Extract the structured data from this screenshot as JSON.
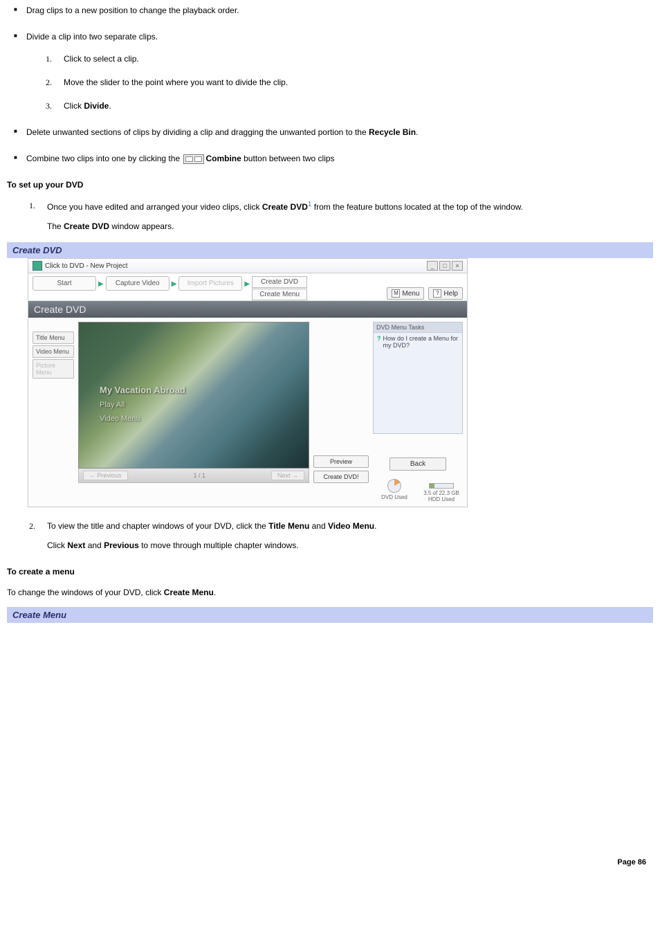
{
  "bullets": {
    "drag": "Drag clips to a new position to change the playback order.",
    "divide_intro": "Divide a clip into two separate clips.",
    "divide_steps": {
      "s1": "Click to select a clip.",
      "s2": "Move the slider to the point where you want to divide the clip.",
      "s3_a": "Click ",
      "s3_b": "Divide",
      "s3_c": "."
    },
    "delete_a": "Delete unwanted sections of clips by dividing a clip and dragging the unwanted portion to the ",
    "delete_b": "Recycle Bin",
    "delete_c": ".",
    "combine_a": "Combine two clips into one by clicking the ",
    "combine_b": "Combine",
    "combine_c": " button between two clips"
  },
  "setup_heading": "To set up your DVD",
  "setup": {
    "s1_a": "Once you have edited and arranged your video clips, click ",
    "s1_b": "Create DVD",
    "s1_sup": "1",
    "s1_c": " from the feature buttons located at the top of the window.",
    "s1_follow_a": "The ",
    "s1_follow_b": "Create DVD",
    "s1_follow_c": " window appears."
  },
  "caption_create_dvd": "Create DVD",
  "sshot": {
    "title": "Click to DVD - New Project",
    "tabs": {
      "start": "Start",
      "capture": "Capture Video",
      "import": "Import Pictures",
      "create_dvd": "Create DVD",
      "create_menu": "Create Menu"
    },
    "top_right": {
      "menu": "Menu",
      "help": "Help",
      "m": "M",
      "q": "?"
    },
    "banner": "Create DVD",
    "left_tabs": {
      "title_menu": "Title Menu",
      "video_menu": "Video Menu",
      "picture_menu": "Picture Menu"
    },
    "overlay": {
      "title": "My Vacation Abroad",
      "play": "Play All",
      "vmenu": "Video Menu"
    },
    "pager": {
      "prev": "← Previous",
      "count": "1 / 1",
      "next": "Next →"
    },
    "mid_right": {
      "preview": "Preview",
      "create": "Create DVD!"
    },
    "task": {
      "hdr": "DVD Menu Tasks",
      "q": "How do I create a Menu for my DVD?"
    },
    "back": "Back",
    "usage": {
      "dvd_val": "",
      "dvd_lbl": "DVD Used",
      "hdd_val": "3.5 of 22.3 GB",
      "hdd_lbl": "HDD Used"
    }
  },
  "setup2": {
    "s2_a": "To view the title and chapter windows of your DVD, click the ",
    "s2_b": "Title Menu",
    "s2_c": " and ",
    "s2_d": "Video Menu",
    "s2_e": ".",
    "s2_follow_a": "Click ",
    "s2_follow_b": "Next",
    "s2_follow_c": " and ",
    "s2_follow_d": "Previous",
    "s2_follow_e": " to move through multiple chapter windows."
  },
  "create_menu_heading": "To create a menu",
  "create_menu_para_a": "To change the windows of your DVD, click ",
  "create_menu_para_b": "Create Menu",
  "create_menu_para_c": ".",
  "caption_create_menu": "Create Menu",
  "footer": "Page 86"
}
